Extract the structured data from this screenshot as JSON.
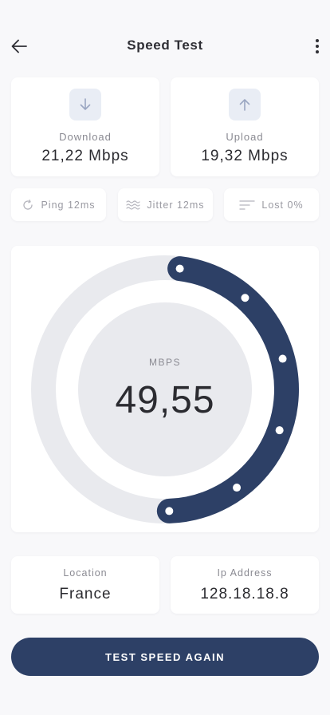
{
  "header": {
    "title": "Speed Test",
    "back_icon": "arrow-left-icon",
    "menu_icon": "more-vertical-icon"
  },
  "speeds": {
    "download": {
      "label": "Download",
      "value": "21,22 Mbps",
      "icon": "arrow-down-icon"
    },
    "upload": {
      "label": "Upload",
      "value": "19,32 Mbps",
      "icon": "arrow-up-icon"
    }
  },
  "stats": {
    "ping": {
      "label": "Ping 12ms",
      "icon": "refresh-icon"
    },
    "jitter": {
      "label": "Jitter 12ms",
      "icon": "waves-icon"
    },
    "lost": {
      "label": "Lost 0%",
      "icon": "lines-icon"
    }
  },
  "gauge": {
    "unit": "MBPS",
    "value": "49,55",
    "fill_fraction": 0.5
  },
  "info": {
    "location": {
      "label": "Location",
      "value": "France"
    },
    "ip": {
      "label": "Ip Address",
      "value": "128.18.18.8"
    }
  },
  "cta": {
    "label": "TEST SPEED AGAIN"
  },
  "colors": {
    "accent": "#2D4066",
    "track": "#E9EAEE",
    "background": "#F8F8FA",
    "icon_tint": "#9AA6C2"
  }
}
